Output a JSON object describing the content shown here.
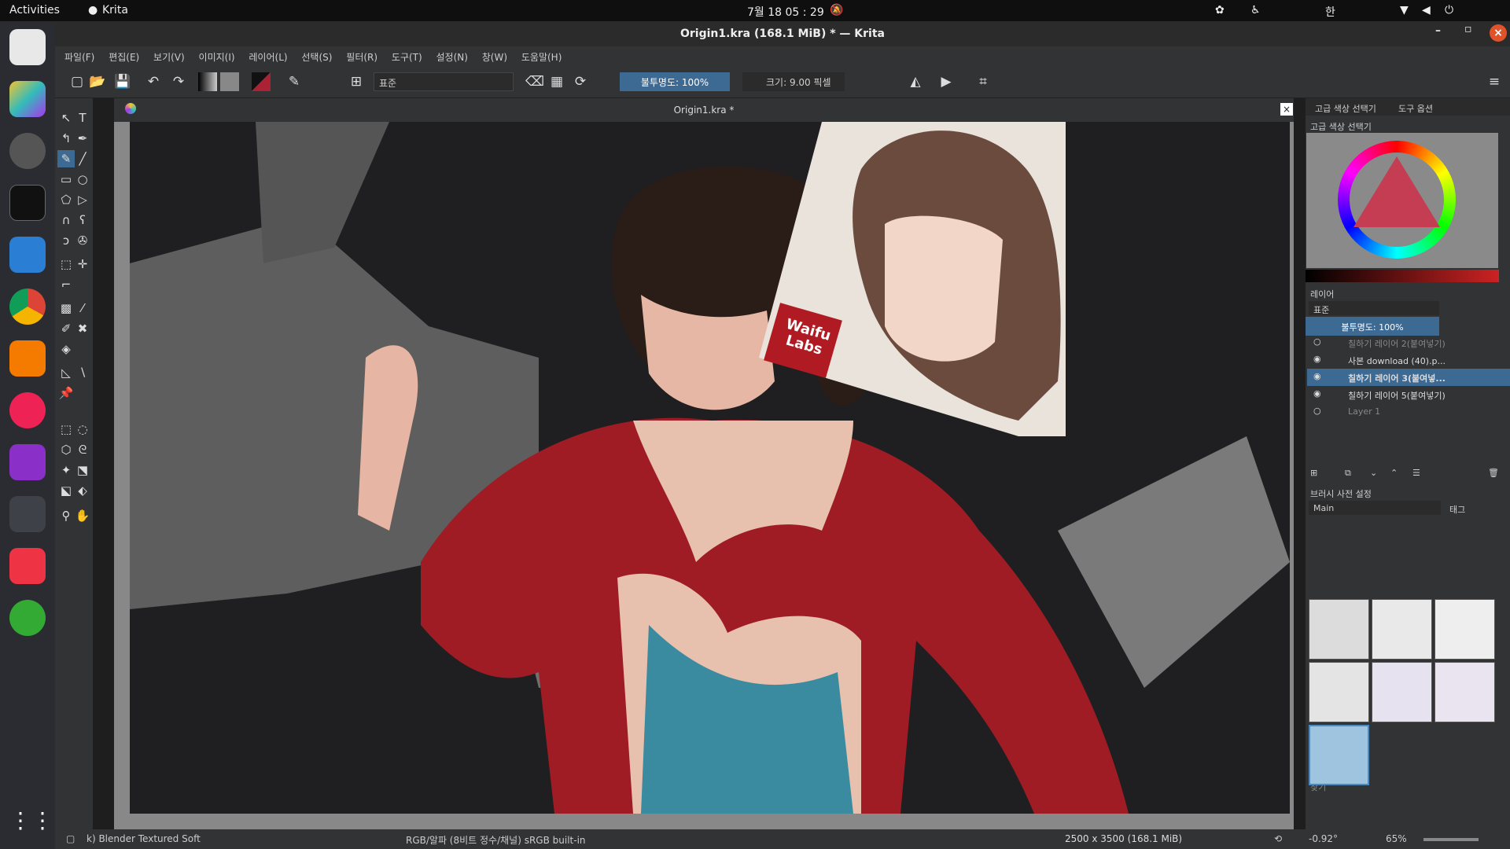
{
  "topbar": {
    "activities": "Activities",
    "app": "Krita",
    "clock": "7월 18  05 : 29",
    "ime": "한"
  },
  "window": {
    "title": "Origin1.kra (168.1 MiB)  * — Krita"
  },
  "menu": [
    "파일(F)",
    "편집(E)",
    "보기(V)",
    "이미지(I)",
    "레이어(L)",
    "선택(S)",
    "필터(R)",
    "도구(T)",
    "설정(N)",
    "창(W)",
    "도움말(H)"
  ],
  "toolbar": {
    "blend_mode": "표준",
    "opacity": "불투명도: 100%",
    "size": "크기: 9.00 픽셀"
  },
  "document": {
    "tab": "Origin1.kra *"
  },
  "right_panel": {
    "tabs": [
      "고급 색상 선택기",
      "도구 옵션"
    ],
    "color_title": "고급 색상 선택기",
    "layers_title": "레이어",
    "layer_blend": "표준",
    "layer_opacity": "불투명도:  100%",
    "layers": [
      {
        "name": "칠하기 레이어 2(붙여넣기)",
        "visible": false
      },
      {
        "name": "사본 download (40).p...",
        "visible": true
      },
      {
        "name": "칠하기 레이어 3(붙여넣...",
        "visible": true,
        "selected": true
      },
      {
        "name": "칠하기 레이어 5(붙여넣기)",
        "visible": true
      },
      {
        "name": "Layer 1",
        "visible": false
      }
    ],
    "brush_title": "브러시 사전 설정",
    "brush_set": "Main",
    "tag": "태그",
    "search": "찾기"
  },
  "canvas_stamp": "Waifu Labs",
  "status": {
    "brush": "k) Blender Textured Soft",
    "color": "RGB/알파 (8비트 정수/채널)  sRGB built-in",
    "dims": "2500 x 3500 (168.1 MiB)",
    "rotation": "-0.92°",
    "zoom": "65%"
  }
}
